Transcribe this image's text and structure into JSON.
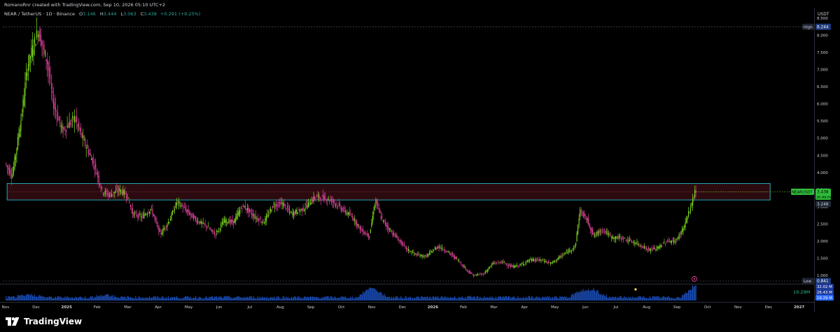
{
  "credit": "RomanoRnr created with TradingView.com, Sep 10, 2026 05:10 UTC+2",
  "legend": {
    "symbol": "NEAR / TetherUS · 1D · Binance",
    "open_label": "O",
    "open": "3.146",
    "high_label": "H",
    "high": "3.444",
    "low_label": "L",
    "low": "3.063",
    "close_label": "C",
    "close": "3.438",
    "change": "+0.291 (+9.25%)"
  },
  "brand": "TradingView",
  "colors": {
    "up": "#7fdc1e",
    "down": "#e0409b",
    "zone_border": "#26a6b2",
    "zone_fill": "#3a0f14",
    "volume": "#1e5bd8",
    "background": "#000000",
    "grid_text": "#d1d4dc"
  },
  "chart_data": {
    "type": "candlestick",
    "title": "NEAR / TetherUS · 1D · Binance",
    "currency_label": "USDT",
    "price_ticks": [
      "8.500",
      "8.000",
      "7.500",
      "7.000",
      "6.500",
      "6.000",
      "5.500",
      "5.000",
      "4.500",
      "4.000",
      "3.500",
      "3.000",
      "2.500",
      "2.000",
      "1.500",
      "1.000"
    ],
    "ylim": [
      0.78,
      8.78
    ],
    "x_labels": [
      "Nov",
      "Dec",
      "2025",
      "Feb",
      "Mar",
      "Apr",
      "May",
      "Jun",
      "Jul",
      "Aug",
      "Sep",
      "Oct",
      "Nov",
      "Dec",
      "2026",
      "Feb",
      "Mar",
      "Apr",
      "May",
      "Jun",
      "Jul",
      "Aug",
      "Sep",
      "Oct",
      "Nov",
      "Dec",
      "2027"
    ],
    "price_path": [
      [
        0,
        4.3
      ],
      [
        0.25,
        3.9
      ],
      [
        0.55,
        5.6
      ],
      [
        0.75,
        7.1
      ],
      [
        1.1,
        8.15
      ],
      [
        1.4,
        7.2
      ],
      [
        1.6,
        6.0
      ],
      [
        1.9,
        5.2
      ],
      [
        2.3,
        5.6
      ],
      [
        2.6,
        4.9
      ],
      [
        2.95,
        4.2
      ],
      [
        3.2,
        3.45
      ],
      [
        3.45,
        3.35
      ],
      [
        3.75,
        3.5
      ],
      [
        4.0,
        3.35
      ],
      [
        4.2,
        2.8
      ],
      [
        4.5,
        2.7
      ],
      [
        4.8,
        2.95
      ],
      [
        5.1,
        2.2
      ],
      [
        5.4,
        2.6
      ],
      [
        5.65,
        3.15
      ],
      [
        6.0,
        2.85
      ],
      [
        6.3,
        2.6
      ],
      [
        6.6,
        2.45
      ],
      [
        6.9,
        2.2
      ],
      [
        7.2,
        2.6
      ],
      [
        7.5,
        2.55
      ],
      [
        7.8,
        3.05
      ],
      [
        8.2,
        2.7
      ],
      [
        8.5,
        2.55
      ],
      [
        8.8,
        3.05
      ],
      [
        9.1,
        3.1
      ],
      [
        9.4,
        2.8
      ],
      [
        9.8,
        2.95
      ],
      [
        10.2,
        3.3
      ],
      [
        10.5,
        3.25
      ],
      [
        10.8,
        3.15
      ],
      [
        11.1,
        2.9
      ],
      [
        11.4,
        2.7
      ],
      [
        11.7,
        2.3
      ],
      [
        11.95,
        2.15
      ],
      [
        12.15,
        3.2
      ],
      [
        12.35,
        2.65
      ],
      [
        12.6,
        2.35
      ],
      [
        12.9,
        2.05
      ],
      [
        13.2,
        1.75
      ],
      [
        13.5,
        1.6
      ],
      [
        13.8,
        1.55
      ],
      [
        14.2,
        1.85
      ],
      [
        14.5,
        1.7
      ],
      [
        14.8,
        1.5
      ],
      [
        15.1,
        1.2
      ],
      [
        15.35,
        1.0
      ],
      [
        15.7,
        1.05
      ],
      [
        16.0,
        1.35
      ],
      [
        16.3,
        1.4
      ],
      [
        16.6,
        1.25
      ],
      [
        16.9,
        1.3
      ],
      [
        17.2,
        1.45
      ],
      [
        17.6,
        1.45
      ],
      [
        17.9,
        1.35
      ],
      [
        18.3,
        1.6
      ],
      [
        18.7,
        1.85
      ],
      [
        18.85,
        2.9
      ],
      [
        19.1,
        2.6
      ],
      [
        19.3,
        2.15
      ],
      [
        19.6,
        2.35
      ],
      [
        19.9,
        2.1
      ],
      [
        20.2,
        2.1
      ],
      [
        20.5,
        2.0
      ],
      [
        20.8,
        1.9
      ],
      [
        21.1,
        1.75
      ],
      [
        21.4,
        1.8
      ],
      [
        21.7,
        2.0
      ],
      [
        22.0,
        2.0
      ],
      [
        22.25,
        2.4
      ],
      [
        22.45,
        2.9
      ],
      [
        22.62,
        3.44
      ]
    ],
    "volume_spikes": [
      [
        12.0,
        0.9
      ],
      [
        18.9,
        0.55
      ],
      [
        19.3,
        0.5
      ],
      [
        22.6,
        0.95
      ],
      [
        0.8,
        0.25
      ],
      [
        3.3,
        0.2
      ]
    ],
    "resistance_zone": {
      "top": 3.68,
      "bottom": 3.2,
      "x_start": 0.05,
      "x_end": 25.05
    },
    "price_labels": {
      "high": {
        "label": "High",
        "value": "8.244"
      },
      "low": {
        "label": "Low",
        "value": "0.841"
      },
      "last": {
        "label": "NEARUSDT",
        "value": "3.438",
        "countdown": "20:49:04",
        "prev": "3.248"
      }
    },
    "volume_labels": [
      "32.02 M",
      "26.43 M",
      "19.29 M"
    ],
    "volume_readout": "19.29M"
  }
}
